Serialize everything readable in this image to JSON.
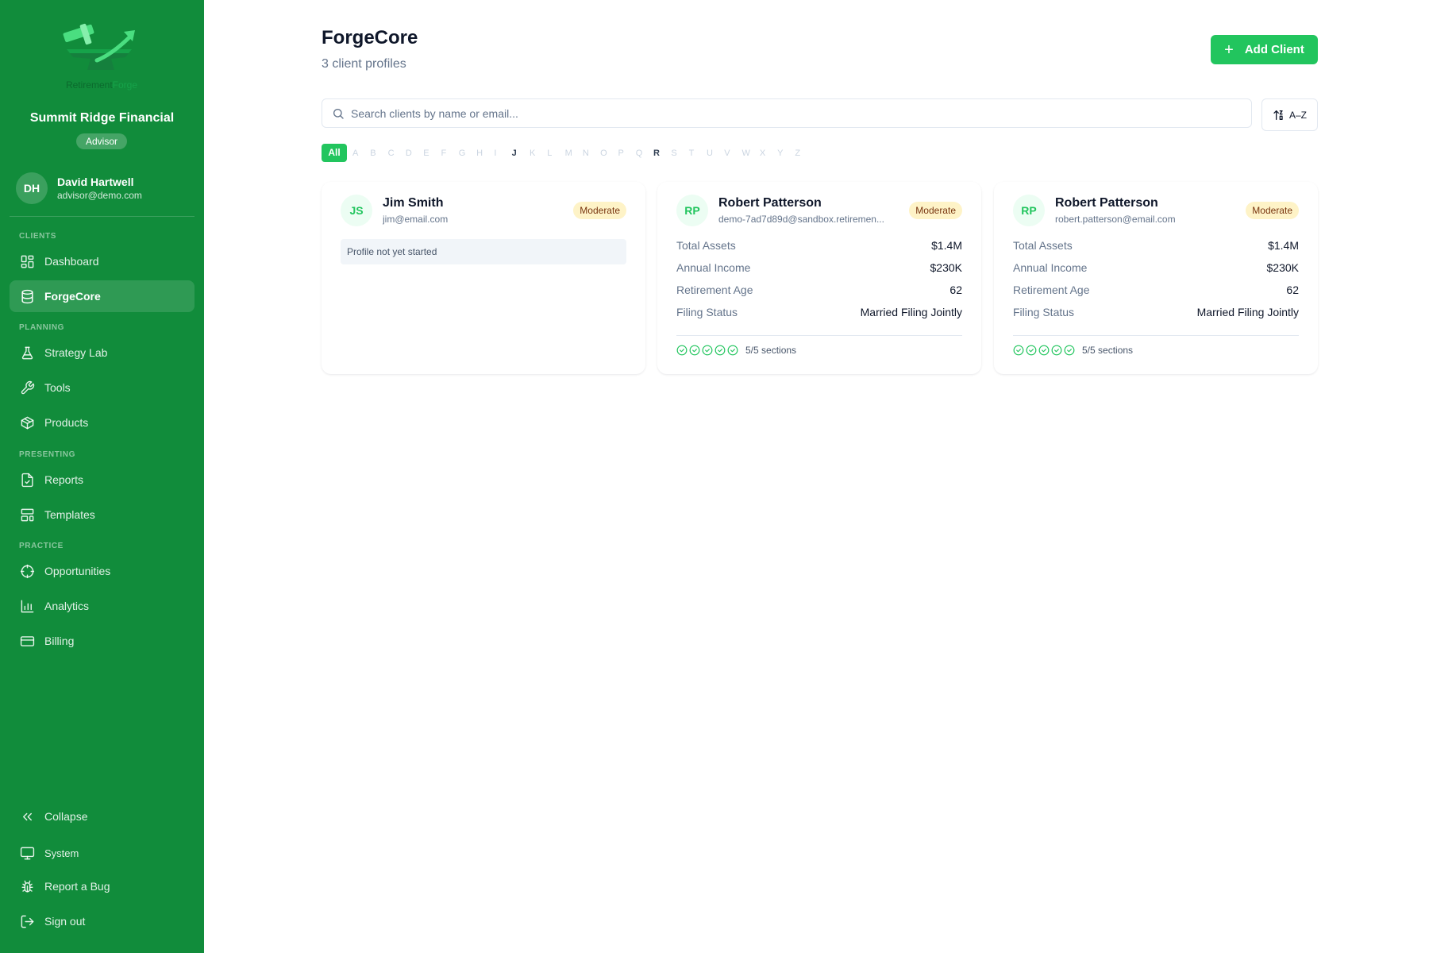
{
  "sidebar": {
    "logo": {
      "part1": "Retirement",
      "part2": "Forge"
    },
    "org_name": "Summit Ridge Financial",
    "role": "Advisor",
    "user": {
      "initials": "DH",
      "name": "David Hartwell",
      "email": "advisor@demo.com"
    },
    "sections": {
      "clients": "CLIENTS",
      "planning": "PLANNING",
      "presenting": "PRESENTING",
      "practice": "PRACTICE"
    },
    "items": {
      "dashboard": "Dashboard",
      "forgecore": "ForgeCore",
      "strategy_lab": "Strategy Lab",
      "tools": "Tools",
      "products": "Products",
      "reports": "Reports",
      "templates": "Templates",
      "opportunities": "Opportunities",
      "analytics": "Analytics",
      "billing": "Billing"
    },
    "footer": {
      "collapse": "Collapse",
      "system": "System",
      "report_bug": "Report a Bug",
      "sign_out": "Sign out"
    }
  },
  "main": {
    "title": "ForgeCore",
    "subtitle": "3 client profiles",
    "add_button": "Add Client",
    "search": {
      "placeholder": "Search clients by name or email..."
    },
    "sort_label": "A–Z",
    "alphabet": {
      "all": "All",
      "letters": [
        "A",
        "B",
        "C",
        "D",
        "E",
        "F",
        "G",
        "H",
        "I",
        "J",
        "K",
        "L",
        "M",
        "N",
        "O",
        "P",
        "Q",
        "R",
        "S",
        "T",
        "U",
        "V",
        "W",
        "X",
        "Y",
        "Z"
      ],
      "active_letters": [
        "J",
        "R"
      ]
    }
  },
  "field_labels": {
    "total_assets": "Total Assets",
    "annual_income": "Annual Income",
    "retirement_age": "Retirement Age",
    "filing_status": "Filing Status"
  },
  "clients": [
    {
      "initials": "JS",
      "name": "Jim Smith",
      "email": "jim@email.com",
      "risk": "Moderate",
      "empty_message": "Profile not yet started"
    },
    {
      "initials": "RP",
      "name": "Robert Patterson",
      "email": "demo-7ad7d89d@sandbox.retiremen...",
      "risk": "Moderate",
      "total_assets": "$1.4M",
      "annual_income": "$230K",
      "retirement_age": "62",
      "filing_status": "Married Filing Jointly",
      "sections_done": 5,
      "sections_total": 5,
      "sections_text": "5/5 sections"
    },
    {
      "initials": "RP",
      "name": "Robert Patterson",
      "email": "robert.patterson@email.com",
      "risk": "Moderate",
      "total_assets": "$1.4M",
      "annual_income": "$230K",
      "retirement_age": "62",
      "filing_status": "Married Filing Jointly",
      "sections_done": 5,
      "sections_total": 5,
      "sections_text": "5/5 sections"
    }
  ],
  "colors": {
    "sidebar_bg": "#118c3b",
    "accent": "#22c55e",
    "badge_bg": "#fef3c7",
    "badge_text": "#78350f"
  }
}
